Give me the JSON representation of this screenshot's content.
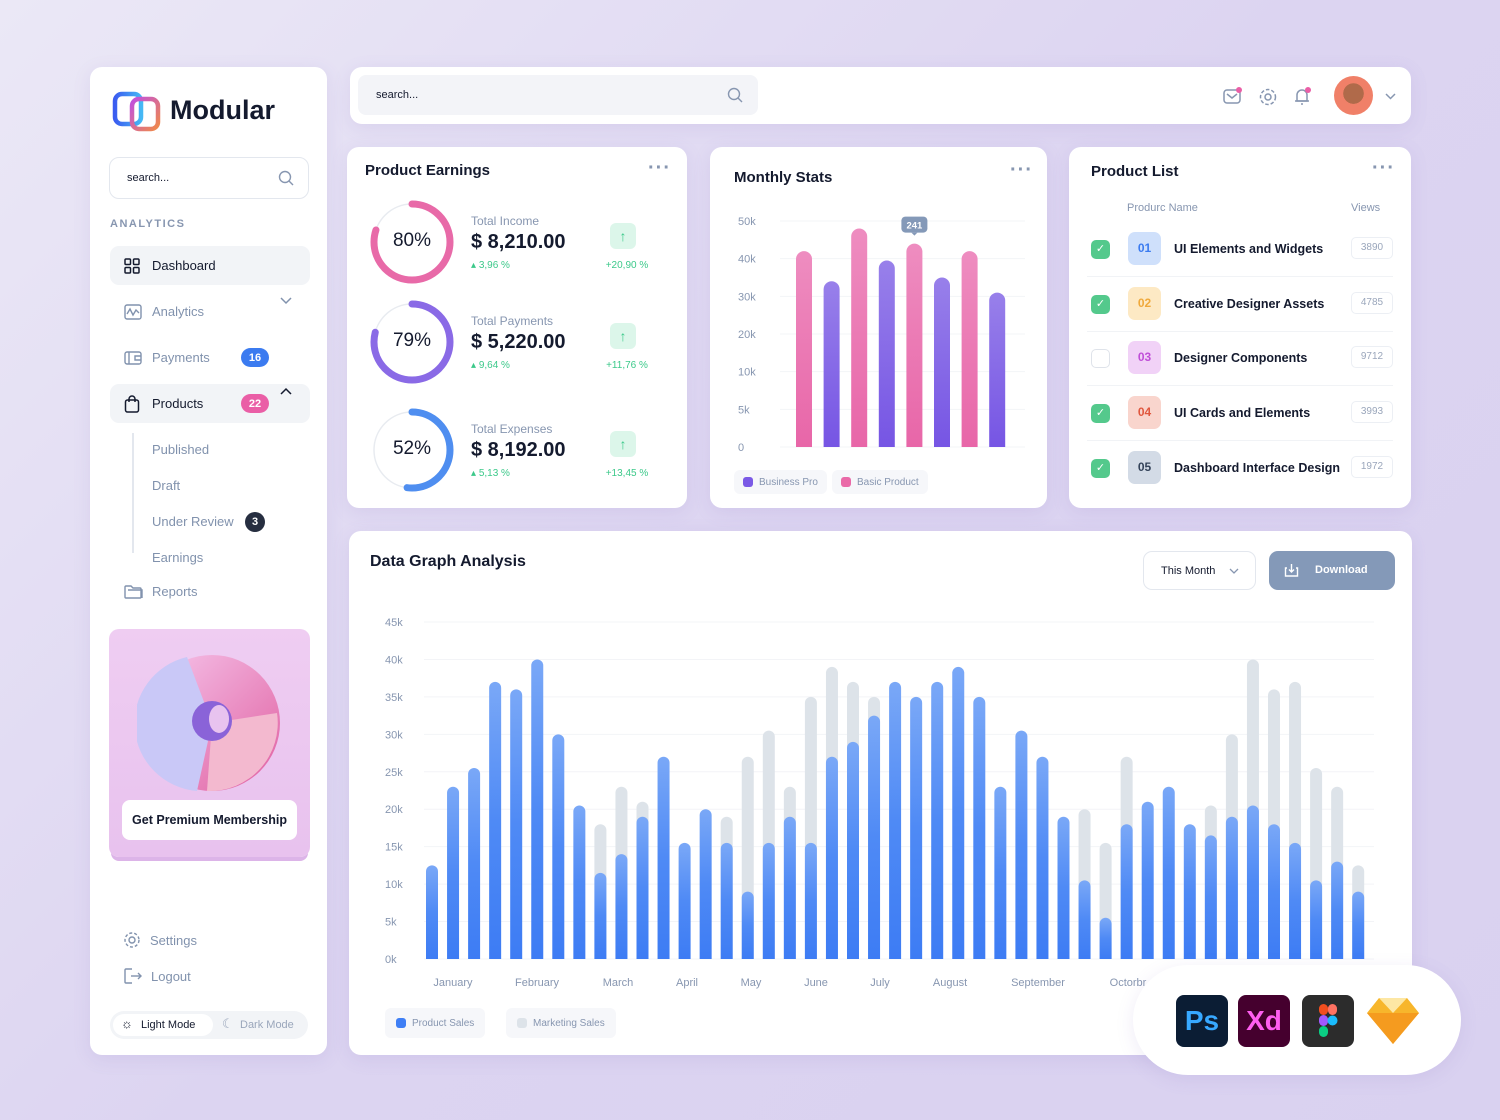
{
  "brand": {
    "name": "Modular"
  },
  "sidebar": {
    "search_placeholder": "search...",
    "section_label": "ANALYTICS",
    "items": [
      {
        "label": "Dashboard",
        "icon": "grid-icon",
        "active": true
      },
      {
        "label": "Analytics",
        "icon": "chart-icon",
        "expandable": true
      },
      {
        "label": "Payments",
        "icon": "wallet-icon",
        "badge": "16",
        "badge_color": "#3b7bf0"
      },
      {
        "label": "Products",
        "icon": "bag-icon",
        "badge": "22",
        "badge_color": "#ea5ea6",
        "expanded": true
      },
      {
        "label": "Reports",
        "icon": "folder-icon"
      }
    ],
    "product_subitems": [
      {
        "label": "Published"
      },
      {
        "label": "Draft"
      },
      {
        "label": "Under Review",
        "badge": "3"
      },
      {
        "label": "Earnings"
      }
    ],
    "premium_button": "Get Premium Membership",
    "settings": "Settings",
    "logout": "Logout",
    "mode": {
      "light": "Light Mode",
      "dark": "Dark Mode",
      "selected": "light"
    }
  },
  "topbar": {
    "search_placeholder": "search...",
    "icons": [
      "mail-icon",
      "gear-icon",
      "bell-icon"
    ],
    "notification_dot_color": "#ea5ea6"
  },
  "earnings": {
    "title": "Product Earnings",
    "items": [
      {
        "percent": "80%",
        "fraction": 0.8,
        "label": "Total Income",
        "value": "$ 8,210.00",
        "change": "3,96 %",
        "growth": "+20,90 %",
        "color": "#e86aa8"
      },
      {
        "percent": "79%",
        "fraction": 0.79,
        "label": "Total Payments",
        "value": "$ 5,220.00",
        "change": "9,64 %",
        "growth": "+11,76 %",
        "color": "#8a6ae6"
      },
      {
        "percent": "52%",
        "fraction": 0.52,
        "label": "Total Expenses",
        "value": "$ 8,192.00",
        "change": "5,13 %",
        "growth": "+13,45 %",
        "color": "#4f8ef0"
      }
    ]
  },
  "monthly": {
    "title": "Monthly Stats",
    "tooltip": "241",
    "legend": [
      {
        "label": "Business Pro",
        "color": "#7b5ae6"
      },
      {
        "label": "Basic Product",
        "color": "#ea6aa8"
      }
    ]
  },
  "product_list": {
    "title": "Product List",
    "col_name": "Produrc Name",
    "col_views": "Views",
    "rows": [
      {
        "checked": true,
        "num": "01",
        "name": "UI Elements and Widgets",
        "views": "3890",
        "bg": "#cfe0fb",
        "fg": "#3b7bf0"
      },
      {
        "checked": true,
        "num": "02",
        "name": "Creative Designer Assets",
        "views": "4785",
        "bg": "#fde9c4",
        "fg": "#f0a93b"
      },
      {
        "checked": false,
        "num": "03",
        "name": "Designer Components",
        "views": "9712",
        "bg": "#f1d2f7",
        "fg": "#c04fd8"
      },
      {
        "checked": true,
        "num": "04",
        "name": "UI Cards and Elements",
        "views": "3993",
        "bg": "#f9d5cd",
        "fg": "#e0573e"
      },
      {
        "checked": true,
        "num": "05",
        "name": "Dashboard Interface Design",
        "views": "1972",
        "bg": "#d3dbe6",
        "fg": "#34435a"
      }
    ]
  },
  "analysis": {
    "title": "Data Graph Analysis",
    "period": "This Month",
    "download": "Download",
    "legend": [
      {
        "label": "Product Sales",
        "color": "#3f7ff5"
      },
      {
        "label": "Marketing Sales",
        "color": "#dde3e9"
      }
    ]
  },
  "tools": [
    "Ps",
    "Xd",
    "figma-icon",
    "sketch-icon"
  ],
  "chart_data": [
    {
      "type": "bar",
      "title": "Monthly Stats",
      "yticks": [
        "0",
        "5k",
        "10k",
        "20k",
        "30k",
        "40k",
        "50k"
      ],
      "ytick_values": [
        0,
        5000,
        10000,
        20000,
        30000,
        40000,
        50000
      ],
      "grid": true,
      "legend_position": "bottom",
      "bars": [
        {
          "series": "Basic Product",
          "value": 42000
        },
        {
          "series": "Business Pro",
          "value": 34000
        },
        {
          "series": "Basic Product",
          "value": 48000
        },
        {
          "series": "Business Pro",
          "value": 39500
        },
        {
          "series": "Basic Product",
          "value": 44000
        },
        {
          "series": "Business Pro",
          "value": 35000
        },
        {
          "series": "Basic Product",
          "value": 42000
        },
        {
          "series": "Business Pro",
          "value": 31000
        }
      ],
      "annotation": "241"
    },
    {
      "type": "bar",
      "title": "Data Graph Analysis",
      "ylim": [
        0,
        45000
      ],
      "yticks": [
        "0k",
        "5k",
        "10k",
        "15k",
        "20k",
        "25k",
        "30k",
        "35k",
        "40k",
        "45k"
      ],
      "x_labels": [
        "January",
        "February",
        "March",
        "April",
        "May",
        "June",
        "July",
        "August",
        "September",
        "Octorbr"
      ],
      "grid": true,
      "legend_position": "bottom-left",
      "series": [
        {
          "name": "Product Sales",
          "values": [
            12.5,
            23,
            25.5,
            37,
            36,
            40,
            30,
            20.5,
            11.5,
            14,
            19,
            27,
            15.5,
            20,
            15.5,
            9,
            15.5,
            19,
            15.5,
            27,
            29,
            32.5,
            37,
            35,
            37,
            39,
            35,
            23,
            30.5,
            27,
            19,
            10.5,
            5.5,
            18,
            21,
            23,
            18,
            16.5,
            19,
            20.5,
            18,
            15.5,
            10.5,
            13,
            9
          ]
        },
        {
          "name": "Marketing Sales",
          "values": [
            0,
            0,
            0,
            0,
            0,
            0,
            0,
            0,
            18,
            23,
            21,
            0,
            0,
            0,
            19,
            27,
            30.5,
            23,
            35,
            39,
            37,
            35,
            0,
            0,
            0,
            0,
            0,
            0,
            0,
            0,
            0,
            20,
            15.5,
            27,
            0,
            0,
            0,
            20.5,
            30,
            40,
            36,
            37,
            25.5,
            23,
            12.5
          ]
        }
      ],
      "value_unit": "k"
    }
  ]
}
